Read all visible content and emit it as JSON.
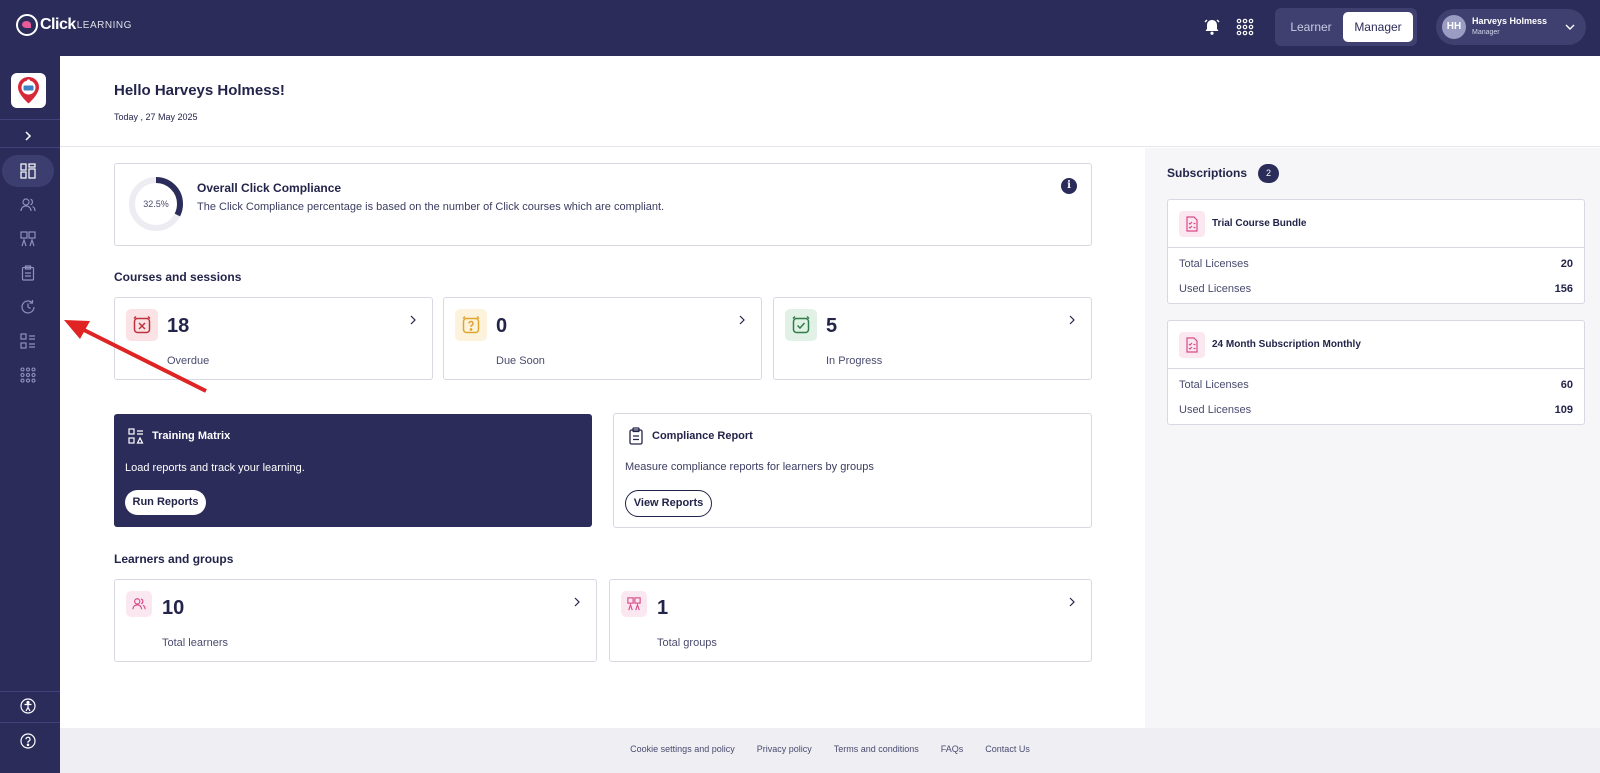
{
  "header": {
    "logo_main": "Click",
    "logo_sub": "LEARNING",
    "mode_learner": "Learner",
    "mode_manager": "Manager",
    "user_initials": "HH",
    "user_name": "Harveys Holmess",
    "user_role": "Manager"
  },
  "greeting": {
    "hello": "Hello Harveys Holmess!",
    "today": "Today , 27 May 2025"
  },
  "compliance": {
    "percent_label": "32.5%",
    "percent_value": 32.5,
    "title": "Overall Click Compliance",
    "description": "The Click Compliance percentage is based on the number of Click courses which are compliant.",
    "info_glyph": "i"
  },
  "courses": {
    "title": "Courses and sessions",
    "items": [
      {
        "value": "18",
        "label": "Overdue",
        "icon": "alarm-x-icon",
        "color": "#c0313e"
      },
      {
        "value": "0",
        "label": "Due Soon",
        "icon": "question-clock-icon",
        "color": "#e0a52f"
      },
      {
        "value": "5",
        "label": "In Progress",
        "icon": "check-clock-icon",
        "color": "#2e7d4a"
      }
    ]
  },
  "training_matrix": {
    "title": "Training Matrix",
    "description": "Load reports and track your learning.",
    "button": "Run Reports"
  },
  "compliance_report": {
    "title": "Compliance Report",
    "description": "Measure compliance reports for learners by groups",
    "button": "View Reports"
  },
  "learners": {
    "title": "Learners and groups",
    "items": [
      {
        "value": "10",
        "label": "Total learners",
        "icon": "users-icon"
      },
      {
        "value": "1",
        "label": "Total groups",
        "icon": "groups-icon"
      }
    ]
  },
  "subscriptions": {
    "title": "Subscriptions",
    "count": "2",
    "items": [
      {
        "name": "Trial Course Bundle",
        "total_label": "Total Licenses",
        "total": "20",
        "used_label": "Used Licenses",
        "used": "156"
      },
      {
        "name": "24 Month Subscription Monthly",
        "total_label": "Total Licenses",
        "total": "60",
        "used_label": "Used Licenses",
        "used": "109"
      }
    ]
  },
  "footer": {
    "links": [
      "Cookie settings and policy",
      "Privacy policy",
      "Terms and conditions",
      "FAQs",
      "Contact Us"
    ]
  },
  "colors": {
    "navy": "#2b2c5a",
    "accent_pink": "#e85b9a",
    "annotation_red": "#e02424"
  }
}
